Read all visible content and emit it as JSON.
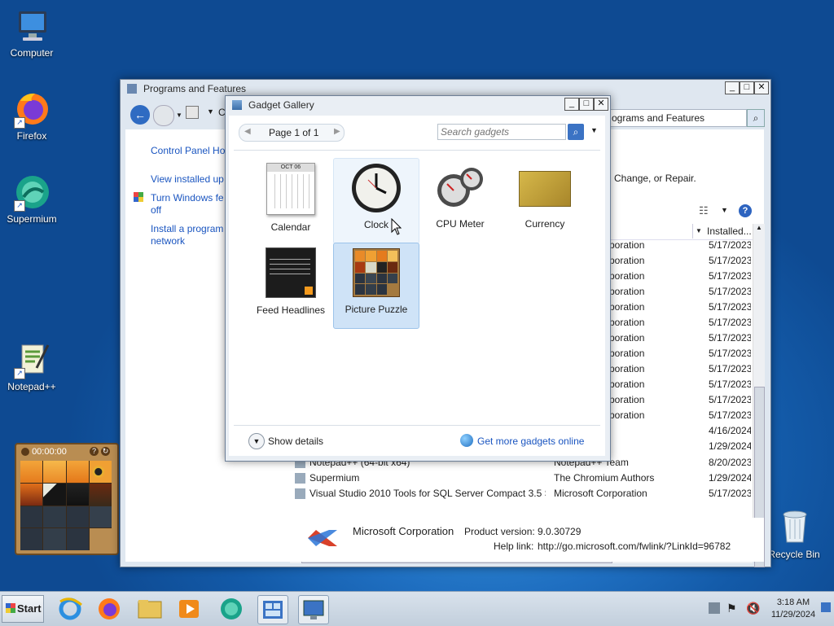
{
  "desktop": {
    "icons": [
      {
        "label": "Computer"
      },
      {
        "label": "Firefox"
      },
      {
        "label": "Supermium"
      },
      {
        "label": "Notepad++"
      },
      {
        "label": "Recycle Bin"
      }
    ]
  },
  "puzzle_widget": {
    "timer": "00:00:00",
    "help": "?"
  },
  "programs_window": {
    "title": "Programs and Features",
    "address_fragment": "C",
    "breadcrumb_right": "ograms and Features",
    "sidebar": {
      "home": "Control Panel Ho",
      "installed_updates": "View installed up",
      "turn_features_line1": "Turn Windows fe",
      "turn_features_line2": "off",
      "install_net_line1": "Install a program",
      "install_net_line2": "network"
    },
    "instruction_fragment": "Change, or Repair.",
    "column_installed": "Installed...",
    "rows_partial": [
      {
        "publisher": "rporation",
        "installed": "5/17/2023"
      },
      {
        "publisher": "rporation",
        "installed": "5/17/2023"
      },
      {
        "publisher": "rporation",
        "installed": "5/17/2023"
      },
      {
        "publisher": "rporation",
        "installed": "5/17/2023"
      },
      {
        "publisher": "rporation",
        "installed": "5/17/2023"
      },
      {
        "publisher": "rporation",
        "installed": "5/17/2023"
      },
      {
        "publisher": "rporation",
        "installed": "5/17/2023"
      },
      {
        "publisher": "rporation",
        "installed": "5/17/2023"
      },
      {
        "publisher": "rporation",
        "installed": "5/17/2023"
      },
      {
        "publisher": "rporation",
        "installed": "5/17/2023"
      },
      {
        "publisher": "rporation",
        "installed": "5/17/2023"
      },
      {
        "publisher": "rporation",
        "installed": "5/17/2023"
      },
      {
        "publisher": "",
        "installed": "4/16/2024"
      },
      {
        "publisher": "",
        "installed": "1/29/2024"
      }
    ],
    "rows_full": [
      {
        "name": "Notepad++ (64-bit x64)",
        "publisher": "Notepad++ Team",
        "installed": "8/20/2023"
      },
      {
        "name": "Supermium",
        "publisher": "The Chromium Authors",
        "installed": "1/29/2024"
      },
      {
        "name": "Visual Studio 2010 Tools for SQL Server Compact 3.5 S...",
        "publisher": "Microsoft Corporation",
        "installed": "5/17/2023"
      }
    ],
    "details": {
      "publisher": "Microsoft Corporation",
      "product_version_label": "Product version:",
      "product_version": "9.0.30729",
      "help_link_label": "Help link:",
      "help_link": "http://go.microsoft.com/fwlink/?LinkId=96782"
    }
  },
  "gadget_gallery": {
    "title": "Gadget Gallery",
    "page_label": "Page 1 of 1",
    "search_placeholder": "Search gadgets",
    "gadgets": [
      {
        "label": "Calendar"
      },
      {
        "label": "Clock"
      },
      {
        "label": "CPU Meter"
      },
      {
        "label": "Currency"
      },
      {
        "label": "Feed Headlines"
      },
      {
        "label": "Picture Puzzle"
      }
    ],
    "calendar_month": "OCT 06",
    "show_details": "Show details",
    "get_more": "Get more gadgets online"
  },
  "taskbar": {
    "start_label": "Start",
    "time": "3:18 AM",
    "date": "11/29/2024"
  },
  "colors": {
    "accent": "#1a55c0",
    "selection": "#cfe3f7",
    "desktop": "#1f6fc1"
  }
}
